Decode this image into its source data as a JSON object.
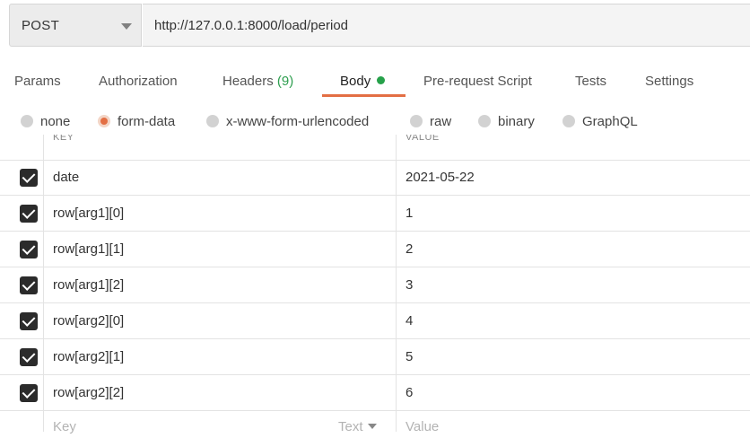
{
  "request": {
    "method": "POST",
    "url": "http://127.0.0.1:8000/load/period"
  },
  "tabs": [
    {
      "label": "Params"
    },
    {
      "label": "Authorization"
    },
    {
      "label": "Headers",
      "count": "(9)"
    },
    {
      "label": "Body",
      "active": true
    },
    {
      "label": "Pre-request Script"
    },
    {
      "label": "Tests"
    },
    {
      "label": "Settings"
    }
  ],
  "body_modes": [
    {
      "label": "none"
    },
    {
      "label": "form-data",
      "selected": true
    },
    {
      "label": "x-www-form-urlencoded"
    },
    {
      "label": "raw"
    },
    {
      "label": "binary"
    },
    {
      "label": "GraphQL"
    }
  ],
  "table": {
    "headers": {
      "key": "KEY",
      "value": "VALUE"
    },
    "rows": [
      {
        "key": "date",
        "value": "2021-05-22",
        "checked": true
      },
      {
        "key": "row[arg1][0]",
        "value": "1",
        "checked": true
      },
      {
        "key": "row[arg1][1]",
        "value": "2",
        "checked": true
      },
      {
        "key": "row[arg1][2]",
        "value": "3",
        "checked": true
      },
      {
        "key": "row[arg2][0]",
        "value": "4",
        "checked": true
      },
      {
        "key": "row[arg2][1]",
        "value": "5",
        "checked": true
      },
      {
        "key": "row[arg2][2]",
        "value": "6",
        "checked": true
      }
    ],
    "new_row": {
      "key_placeholder": "Key",
      "type": "Text",
      "value_placeholder": "Value"
    }
  },
  "colors": {
    "accent": "#e36f44",
    "active_dot": "#26a14a",
    "count": "#2e9e4f"
  }
}
